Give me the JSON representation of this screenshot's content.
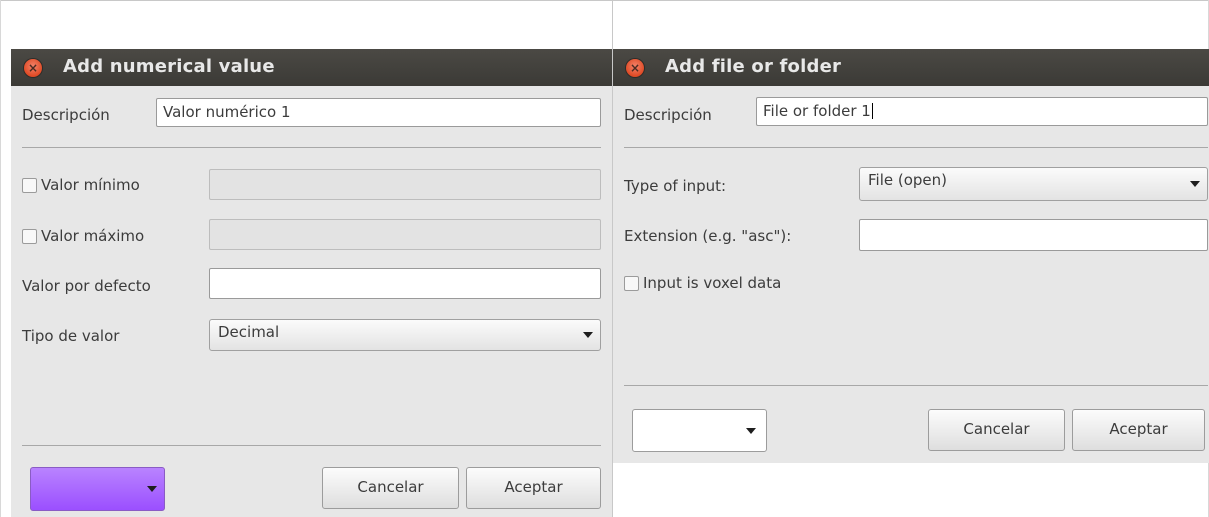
{
  "left_dialog": {
    "title": "Add numerical value",
    "description_label": "Descripción",
    "description_value": "Valor numérico 1",
    "min_label": "Valor mínimo",
    "min_checked": false,
    "max_label": "Valor máximo",
    "max_checked": false,
    "default_label": "Valor por defecto",
    "default_value": "",
    "type_label": "Tipo de valor",
    "type_value": "Decimal",
    "color_value": "#a866ff",
    "cancel_label": "Cancelar",
    "accept_label": "Aceptar"
  },
  "right_dialog": {
    "title": "Add file or folder",
    "description_label": "Descripción",
    "description_value": "File or folder 1",
    "input_type_label": "Type of input:",
    "input_type_value": "File (open)",
    "extension_label": "Extension (e.g. \"asc\"):",
    "extension_value": "",
    "voxel_label": "Input is voxel data",
    "voxel_checked": false,
    "cancel_label": "Cancelar",
    "accept_label": "Aceptar"
  },
  "icons": {
    "close": "close-icon",
    "dropdown": "chevron-down-icon"
  },
  "colors": {
    "titlebar": "#3f3e3a",
    "close_button": "#e2512c",
    "dialog_bg": "#e7e7e7"
  }
}
